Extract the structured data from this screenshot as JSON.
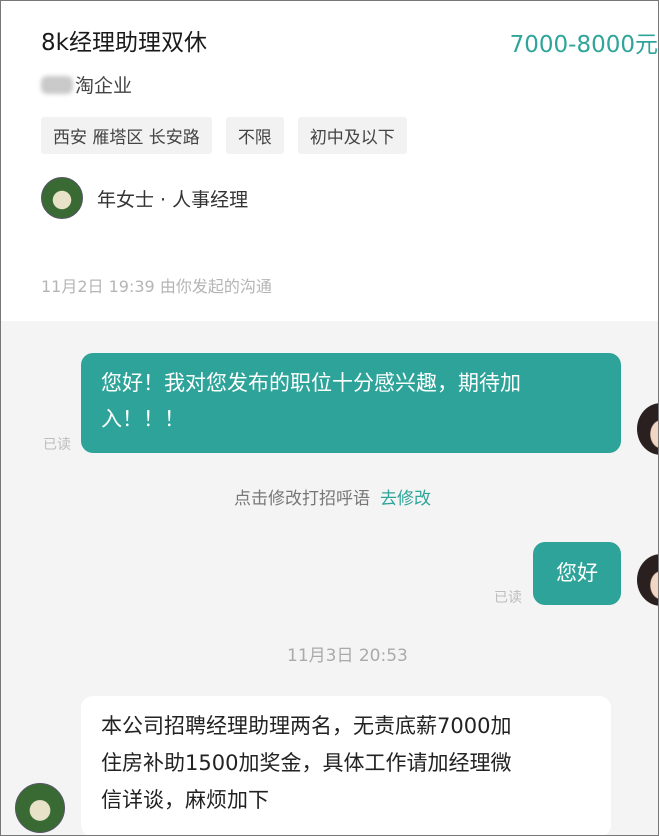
{
  "job": {
    "title": "8k经理助理双休",
    "salary": "7000-8000元",
    "company_visible": "淘企业",
    "tags": [
      "西安 雁塔区 长安路",
      "不限",
      "初中及以下"
    ]
  },
  "recruiter": {
    "name": "年女士 · 人事经理"
  },
  "chat": {
    "started": "11月2日 19:39 由你发起的沟通",
    "messages": [
      {
        "text_line1": "您好！我对您发布的职位十分感兴趣，期待加",
        "text_line2": "入！！！",
        "status": "已读"
      },
      {
        "text": "您好",
        "status": "已读"
      }
    ],
    "edit_hint": "点击修改打招呼语",
    "edit_link": "去修改",
    "time2": "11月3日 20:53",
    "reply": {
      "line1": "本公司招聘经理助理两名，无责底薪7000加",
      "line2": "住房补助1500加奖金，具体工作请加经理微",
      "line3": "信详谈，麻烦加下"
    }
  }
}
